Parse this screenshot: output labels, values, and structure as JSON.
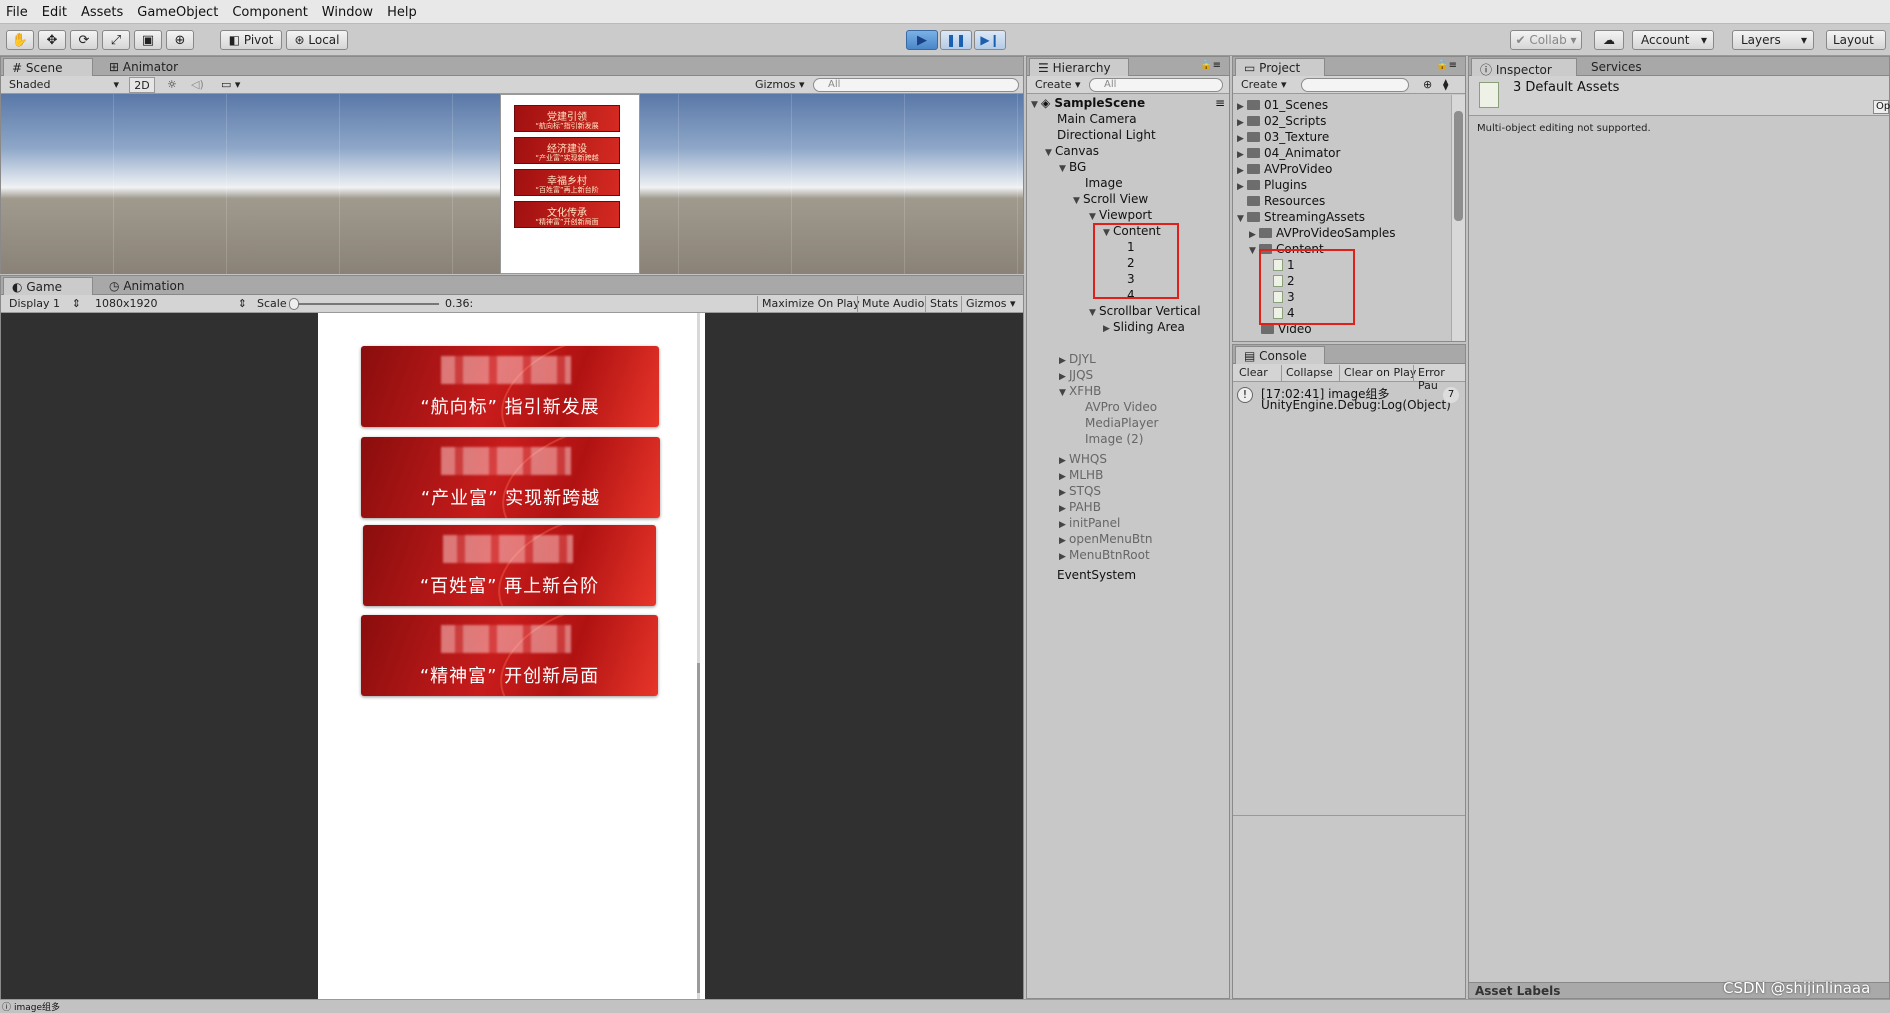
{
  "menu": [
    "File",
    "Edit",
    "Assets",
    "GameObject",
    "Component",
    "Window",
    "Help"
  ],
  "toolbar": {
    "pivot": "Pivot",
    "local": "Local",
    "collab": "Collab",
    "account": "Account",
    "layers": "Layers",
    "layout": "Layout"
  },
  "scene": {
    "tab_scene": "Scene",
    "tab_animator": "Animator",
    "shading": "Shaded",
    "mode2d": "2D",
    "gizmos": "Gizmos",
    "search_placeholder": "All",
    "minis": [
      {
        "t": "党建引领",
        "s": "“航向标”指引新发展"
      },
      {
        "t": "经济建设",
        "s": "“产业富”实现新跨越"
      },
      {
        "t": "幸福乡村",
        "s": "“百姓富”再上新台阶"
      },
      {
        "t": "文化传承",
        "s": "“精神富”开创新局面"
      }
    ]
  },
  "game": {
    "tab_game": "Game",
    "tab_animation": "Animation",
    "display": "Display 1",
    "resolution": "1080x1920",
    "scale_label": "Scale",
    "scale_value": "0.36:",
    "maximize": "Maximize On Play",
    "mute": "Mute Audio",
    "stats": "Stats",
    "gizmos": "Gizmos",
    "banners": [
      "“航向标” 指引新发展",
      "“产业富” 实现新跨越",
      "“百姓富” 再上新台阶",
      "“精神富” 开创新局面"
    ]
  },
  "hierarchy": {
    "tab": "Hierarchy",
    "create": "Create",
    "search_placeholder": "All",
    "rows": [
      "SampleScene",
      "Main Camera",
      "Directional Light",
      "Canvas",
      "BG",
      "Image",
      "Scroll View",
      "Viewport",
      "Content",
      "1",
      "2",
      "3",
      "4",
      "Scrollbar Vertical",
      "Sliding Area",
      "DJYL",
      "JJQS",
      "XFHB",
      "AVPro Video",
      "MediaPlayer",
      "Image (2)",
      "WHQS",
      "MLHB",
      "STQS",
      "PAHB",
      "initPanel",
      "openMenuBtn",
      "MenuBtnRoot",
      "EventSystem"
    ]
  },
  "project": {
    "tab": "Project",
    "create": "Create",
    "rows": [
      "01_Scenes",
      "02_Scripts",
      "03_Texture",
      "04_Animator",
      "AVProVideo",
      "Plugins",
      "Resources",
      "StreamingAssets",
      "AVProVideoSamples",
      "Content",
      "1",
      "2",
      "3",
      "4",
      "Video"
    ]
  },
  "console": {
    "tab": "Console",
    "clear": "Clear",
    "collapse": "Collapse",
    "clear_on_play": "Clear on Play",
    "error_pause": "Error Pau",
    "log_line1": "[17:02:41] image组多",
    "log_line2": "UnityEngine.Debug:Log(Object)",
    "log_count": "7"
  },
  "inspector": {
    "tab": "Inspector",
    "tab_services": "Services",
    "title": "3 Default Assets",
    "note": "Multi-object editing not supported.",
    "open": "Op",
    "asset_labels": "Asset Labels"
  },
  "status": {
    "text": "image组多",
    "watermark": "CSDN @shijinlinaaa"
  }
}
